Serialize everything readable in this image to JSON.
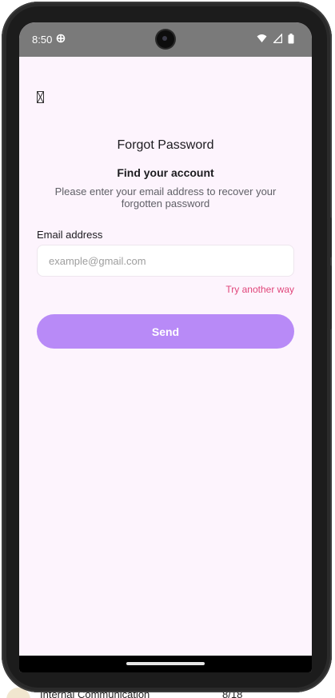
{
  "status_bar": {
    "time": "8:50",
    "app_icon": "settings-app-icon",
    "icons": [
      "wifi-icon",
      "cellular-signal-icon",
      "battery-icon"
    ]
  },
  "header": {
    "back_icon": "back-arrow-icon",
    "title": "Forgot Password"
  },
  "main": {
    "subtitle": "Find your account",
    "description": "Please enter your email address to recover your forgotten password",
    "email_label": "Email address",
    "email_value": "",
    "email_placeholder": "example@gmail.com",
    "try_another_link": "Try another way",
    "send_button": "Send"
  },
  "background_list": {
    "label": "Internal Communication",
    "count": "8/18"
  },
  "colors": {
    "screen_bg": "#fdf4fd",
    "accent_button": "#b88af7",
    "link": "#e0457a",
    "status_bar": "#7a7a7a"
  }
}
